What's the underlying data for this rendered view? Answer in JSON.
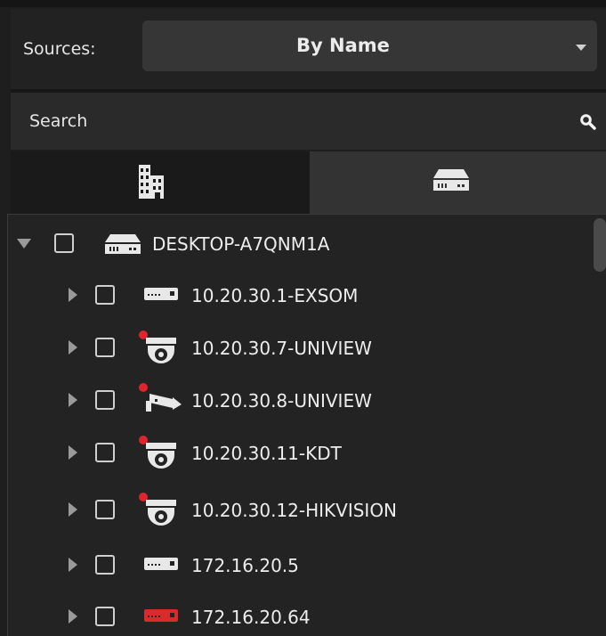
{
  "sources": {
    "label": "Sources:",
    "selected": "By Name"
  },
  "search": {
    "placeholder": "Search"
  },
  "tabs": [
    {
      "icon": "building-icon",
      "selected": false
    },
    {
      "icon": "nvr-icon",
      "selected": true
    }
  ],
  "tree": {
    "root": {
      "label": "DESKTOP-A7QNM1A",
      "icon": "nvr-icon",
      "expanded": true
    },
    "children": [
      {
        "label": "10.20.30.1-EXSOM",
        "icon": "nvr-device-icon"
      },
      {
        "label": "10.20.30.7-UNIVIEW",
        "icon": "dome-camera-icon",
        "status": "alert"
      },
      {
        "label": "10.20.30.8-UNIVIEW",
        "icon": "bullet-camera-icon",
        "status": "alert"
      },
      {
        "label": "10.20.30.11-KDT",
        "icon": "dome-camera-icon",
        "status": "alert"
      },
      {
        "label": "10.20.30.12-HIKVISION",
        "icon": "dome-camera-icon",
        "status": "alert"
      },
      {
        "label": "172.16.20.5",
        "icon": "nvr-device-icon"
      },
      {
        "label": "172.16.20.64",
        "icon": "nvr-device-icon",
        "status": "error"
      }
    ]
  },
  "colors": {
    "alert_dot": "#e0242b",
    "error_device": "#d92b2b"
  }
}
